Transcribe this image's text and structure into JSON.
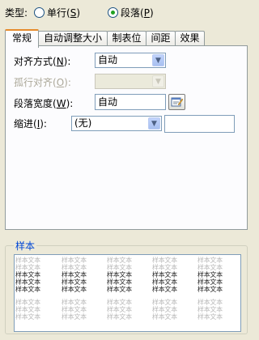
{
  "type_row": {
    "label": "类型:",
    "single": {
      "text": "单行(",
      "key": "S",
      "close": ")",
      "checked": false
    },
    "paragraph": {
      "text": "段落(",
      "key": "P",
      "close": ")",
      "checked": true
    }
  },
  "tabs": [
    "常规",
    "自动调整大小",
    "制表位",
    "间距",
    "效果"
  ],
  "active_tab": "常规",
  "fields": {
    "align": {
      "label": "对齐方式(",
      "key": "N",
      "close": "):",
      "value": "自动"
    },
    "orphan": {
      "label": "孤行对齐(",
      "key": "O",
      "close": "):",
      "value": ""
    },
    "width": {
      "label": "段落宽度(",
      "key": "W",
      "close": "):",
      "value": "自动"
    },
    "indent": {
      "label": "缩进(",
      "key": "I",
      "close": "):",
      "value": "(无)",
      "amount": ""
    }
  },
  "sample": {
    "label": "样本",
    "text": "样本文本",
    "rows": [
      {
        "tone": "grey",
        "cells": [
          "样本文本",
          "样本文本",
          "样本文本",
          "样本文本",
          "样本文本"
        ]
      },
      {
        "tone": "grey",
        "cells": [
          "样本文本",
          "样本文本",
          "样本文本",
          "样本文本",
          "样本文本"
        ]
      },
      {
        "tone": "dark",
        "cells": [
          "样本文本",
          "样本文本",
          "样本文本",
          "样本文本",
          "样本文本"
        ]
      },
      {
        "tone": "dark",
        "cells": [
          "样本文本",
          "样本文本",
          "样本文本",
          "样本文本",
          "样本文本"
        ]
      },
      {
        "tone": "dark",
        "cells": [
          "样本文本",
          "样本文本",
          "样本文本",
          "样本文本",
          "样本文本"
        ]
      },
      {
        "tone": "grey",
        "cells": [
          "样本文本",
          "样本文本",
          "样本文本",
          "样本文本",
          "样本文本"
        ]
      },
      {
        "tone": "grey",
        "cells": [
          "样本文本",
          "样本文本",
          "样本文本",
          "样本文本",
          "样本文本"
        ]
      },
      {
        "tone": "grey",
        "cells": [
          "样本文本",
          "样本文本",
          "样本文本",
          "样本文本",
          "样本文本"
        ]
      }
    ]
  },
  "colors": {
    "accent": "#e68b2c",
    "group_label": "#0046d5",
    "radio_dot": "#21a121"
  },
  "icons": {
    "width_button": "paragraph-width-picker-icon",
    "dropdown": "chevron-down-icon"
  }
}
